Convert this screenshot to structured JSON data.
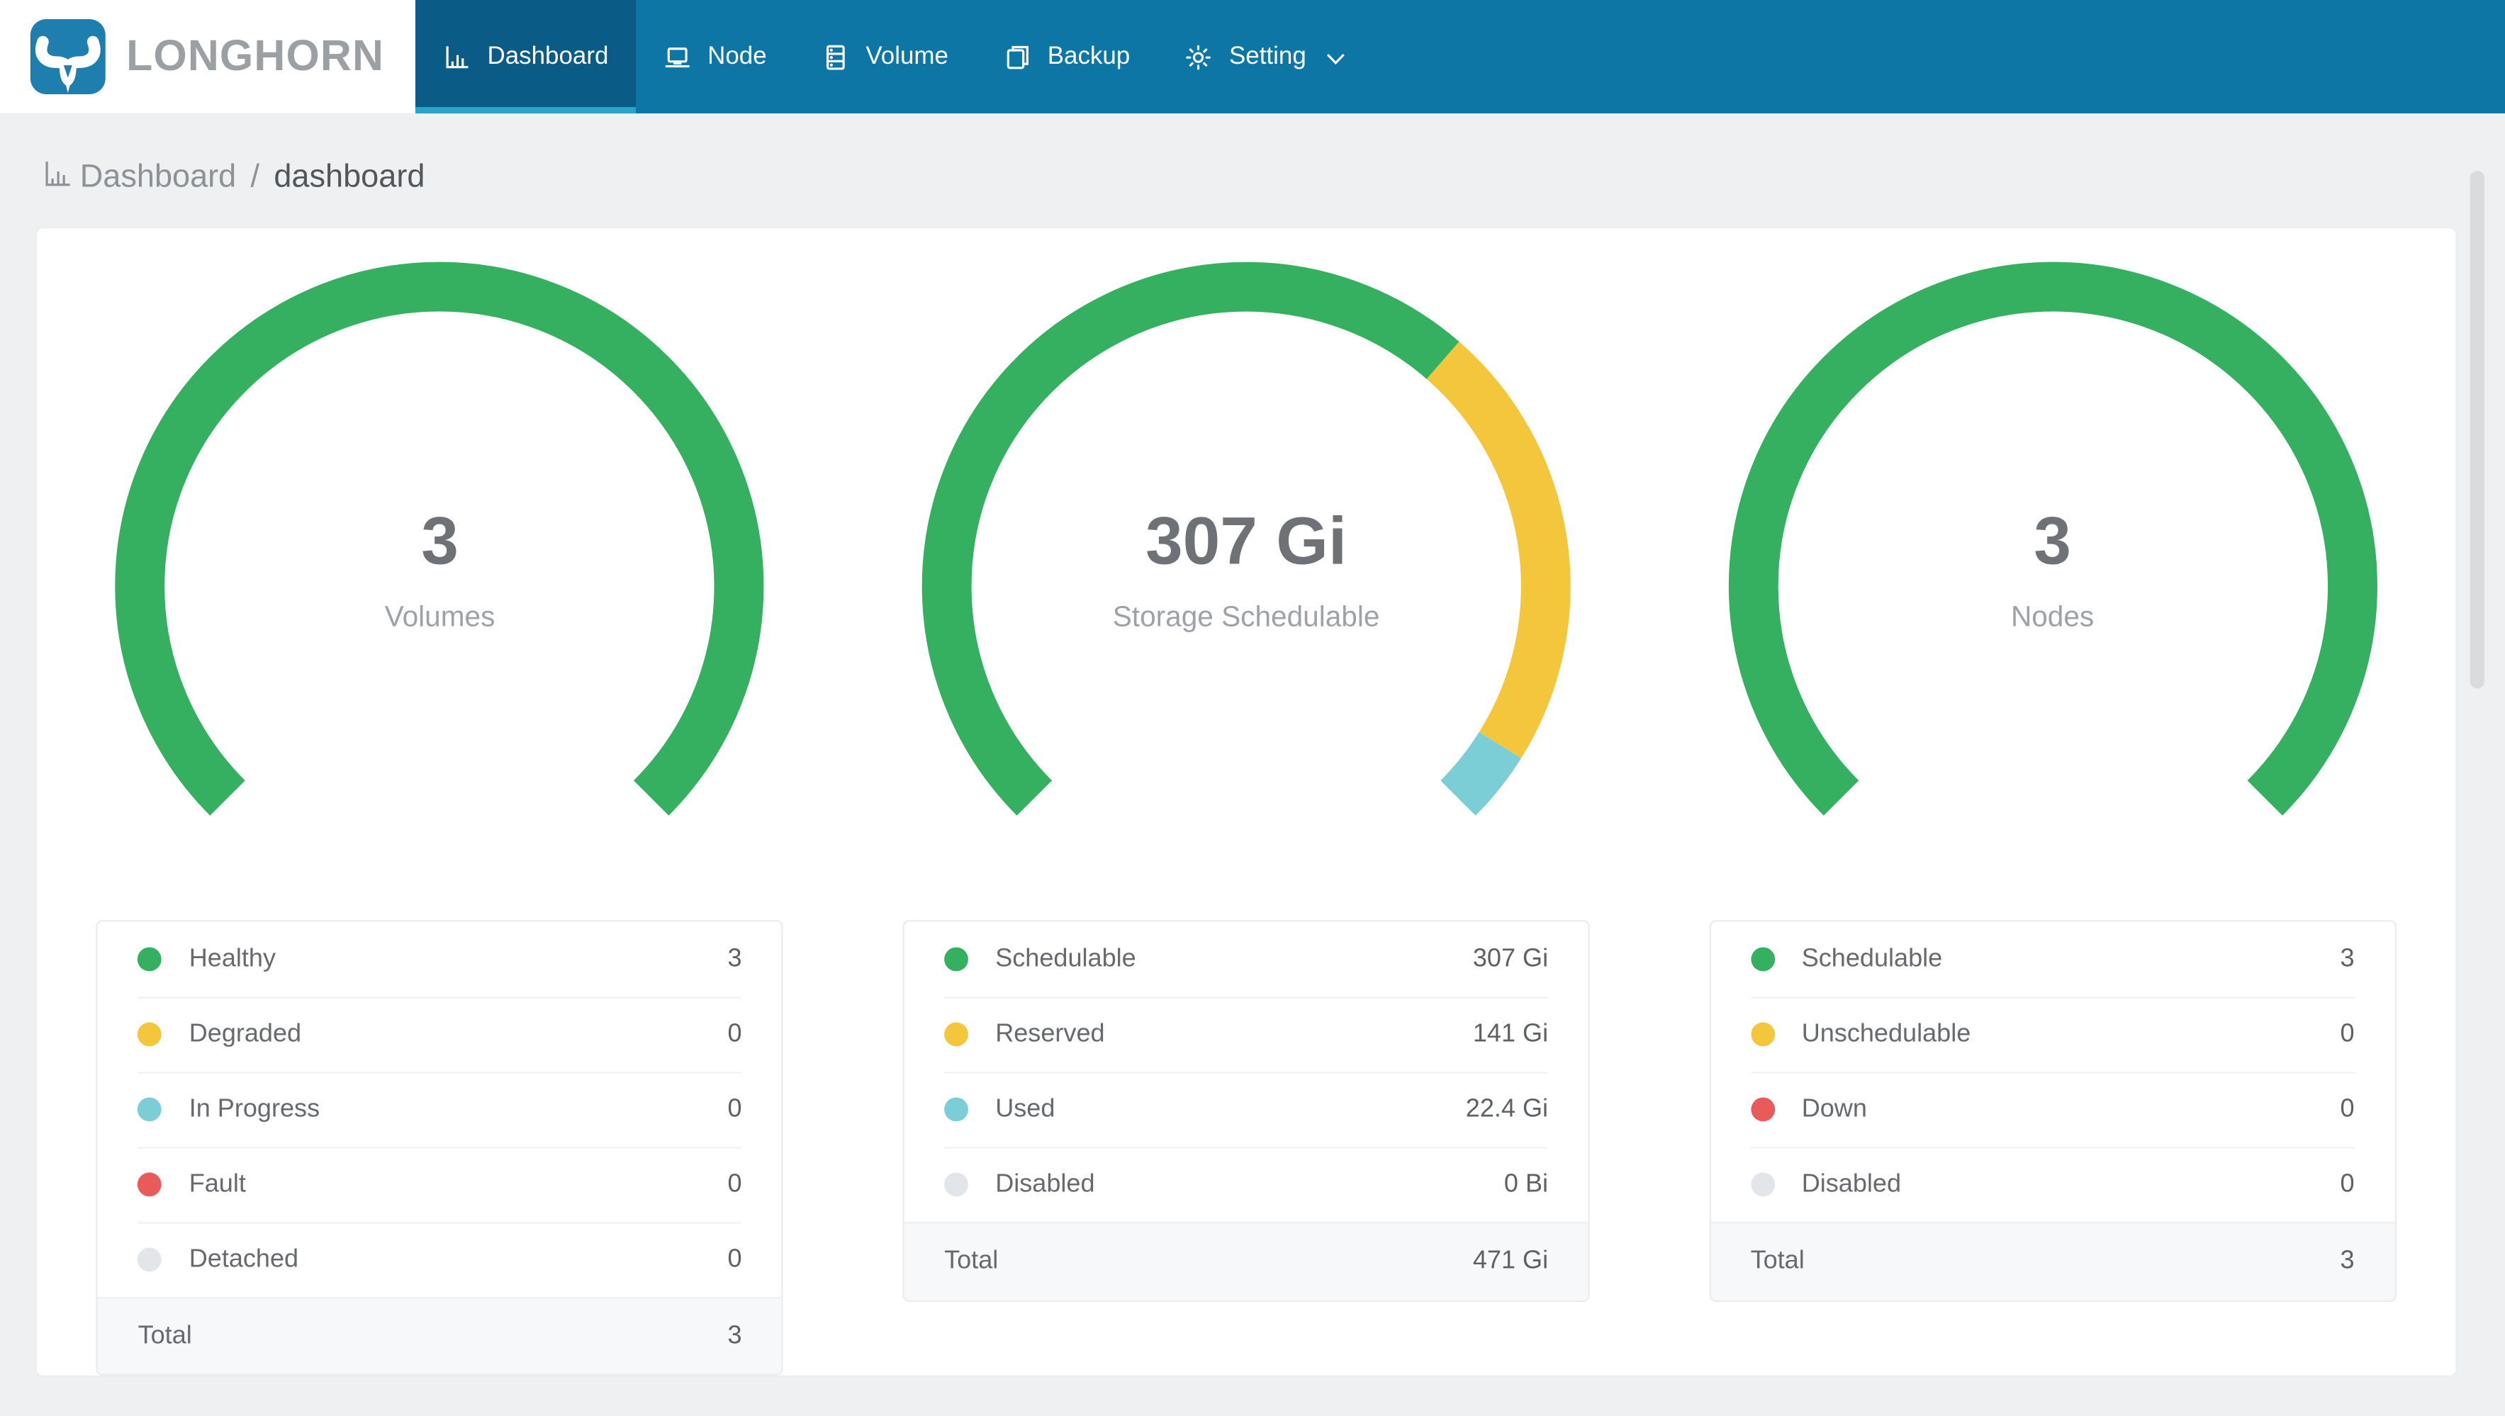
{
  "navbar": {
    "brand": "LONGHORN",
    "items": [
      {
        "label": "Dashboard",
        "icon": "bar-chart-icon",
        "active": true
      },
      {
        "label": "Node",
        "icon": "laptop-icon",
        "active": false
      },
      {
        "label": "Volume",
        "icon": "database-icon",
        "active": false
      },
      {
        "label": "Backup",
        "icon": "copy-icon",
        "active": false
      },
      {
        "label": "Setting",
        "icon": "gear-icon",
        "active": false,
        "has_dropdown": true
      }
    ]
  },
  "breadcrumb": {
    "section": "Dashboard",
    "separator": "/",
    "current": "dashboard"
  },
  "colors": {
    "green": "#35af60",
    "yellow": "#f3c63c",
    "teal": "#7bced6",
    "red": "#e95a5b",
    "gray": "#e2e5e9",
    "navbar": "#0e76a4",
    "navbar_active": "#0a5c87",
    "tab_underline": "#2ba3c6",
    "logo_blue": "#1e7ead",
    "brand_text": "#9ba0a5"
  },
  "cards": [
    {
      "gauge": {
        "value": "3",
        "label": "Volumes",
        "segments": [
          {
            "color": "green",
            "fraction": 1
          }
        ]
      },
      "legend": {
        "rows": [
          {
            "color": "green",
            "label": "Healthy",
            "value": "3"
          },
          {
            "color": "yellow",
            "label": "Degraded",
            "value": "0"
          },
          {
            "color": "teal",
            "label": "In Progress",
            "value": "0"
          },
          {
            "color": "red",
            "label": "Fault",
            "value": "0"
          },
          {
            "color": "gray",
            "label": "Detached",
            "value": "0"
          }
        ],
        "total_label": "Total",
        "total_value": "3"
      }
    },
    {
      "gauge": {
        "value": "307 Gi",
        "label": "Storage Schedulable",
        "segments": [
          {
            "color": "green",
            "fraction": 0.652
          },
          {
            "color": "yellow",
            "fraction": 0.3
          },
          {
            "color": "teal",
            "fraction": 0.048
          }
        ]
      },
      "legend": {
        "rows": [
          {
            "color": "green",
            "label": "Schedulable",
            "value": "307 Gi"
          },
          {
            "color": "yellow",
            "label": "Reserved",
            "value": "141 Gi"
          },
          {
            "color": "teal",
            "label": "Used",
            "value": "22.4 Gi"
          },
          {
            "color": "gray",
            "label": "Disabled",
            "value": "0 Bi"
          }
        ],
        "total_label": "Total",
        "total_value": "471 Gi"
      }
    },
    {
      "gauge": {
        "value": "3",
        "label": "Nodes",
        "segments": [
          {
            "color": "green",
            "fraction": 1
          }
        ]
      },
      "legend": {
        "rows": [
          {
            "color": "green",
            "label": "Schedulable",
            "value": "3"
          },
          {
            "color": "yellow",
            "label": "Unschedulable",
            "value": "0"
          },
          {
            "color": "red",
            "label": "Down",
            "value": "0"
          },
          {
            "color": "gray",
            "label": "Disabled",
            "value": "0"
          }
        ],
        "total_label": "Total",
        "total_value": "3"
      }
    }
  ],
  "chart_data": [
    {
      "type": "donut-gauge",
      "title": "Volumes",
      "center_value": "3",
      "arc": {
        "start_angle": 225,
        "end_angle": -45,
        "sweep_degrees": 270
      },
      "series": [
        {
          "name": "Healthy",
          "value": 3,
          "color": "#35af60"
        },
        {
          "name": "Degraded",
          "value": 0,
          "color": "#f3c63c"
        },
        {
          "name": "In Progress",
          "value": 0,
          "color": "#7bced6"
        },
        {
          "name": "Fault",
          "value": 0,
          "color": "#e95a5b"
        },
        {
          "name": "Detached",
          "value": 0,
          "color": "#e2e5e9"
        }
      ],
      "total": 3
    },
    {
      "type": "donut-gauge",
      "title": "Storage Schedulable",
      "center_value": "307 Gi",
      "unit": "Gi",
      "arc": {
        "start_angle": 225,
        "end_angle": -45,
        "sweep_degrees": 270
      },
      "series": [
        {
          "name": "Schedulable",
          "value": 307,
          "color": "#35af60"
        },
        {
          "name": "Reserved",
          "value": 141,
          "color": "#f3c63c"
        },
        {
          "name": "Used",
          "value": 22.4,
          "color": "#7bced6"
        },
        {
          "name": "Disabled",
          "value": 0,
          "color": "#e2e5e9"
        }
      ],
      "total": 471
    },
    {
      "type": "donut-gauge",
      "title": "Nodes",
      "center_value": "3",
      "arc": {
        "start_angle": 225,
        "end_angle": -45,
        "sweep_degrees": 270
      },
      "series": [
        {
          "name": "Schedulable",
          "value": 3,
          "color": "#35af60"
        },
        {
          "name": "Unschedulable",
          "value": 0,
          "color": "#f3c63c"
        },
        {
          "name": "Down",
          "value": 0,
          "color": "#e95a5b"
        },
        {
          "name": "Disabled",
          "value": 0,
          "color": "#e2e5e9"
        }
      ],
      "total": 3
    }
  ]
}
